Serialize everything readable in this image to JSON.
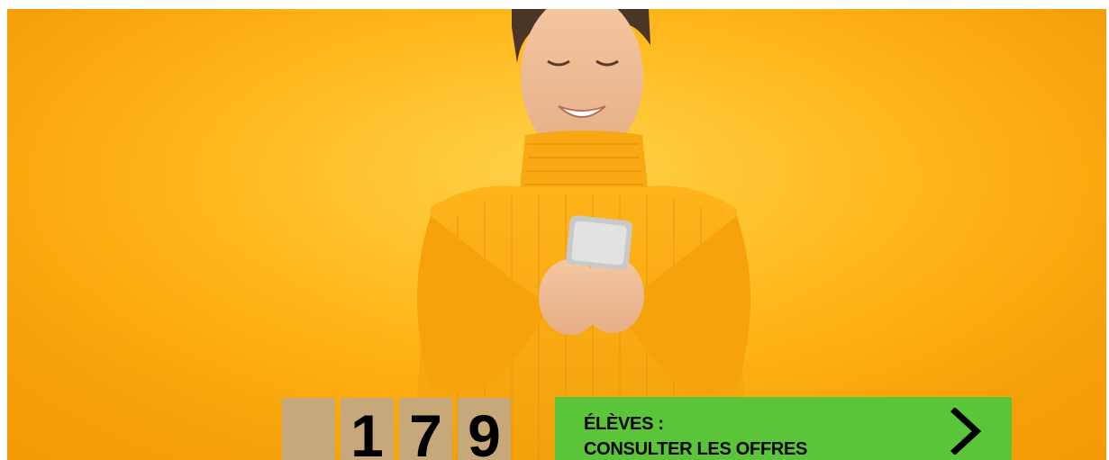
{
  "hero": {
    "image": "woman-in-yellow-turtleneck-using-smartphone",
    "background_color": "#ffb313"
  },
  "counter": {
    "digits": [
      "",
      "1",
      "7",
      "9"
    ],
    "tile_color": "#c7a87b"
  },
  "cta": {
    "line1": "ÉLÈVES :",
    "line2": "CONSULTER LES OFFRES",
    "icon": "chevron-right-icon",
    "color": "#5bc53a"
  }
}
